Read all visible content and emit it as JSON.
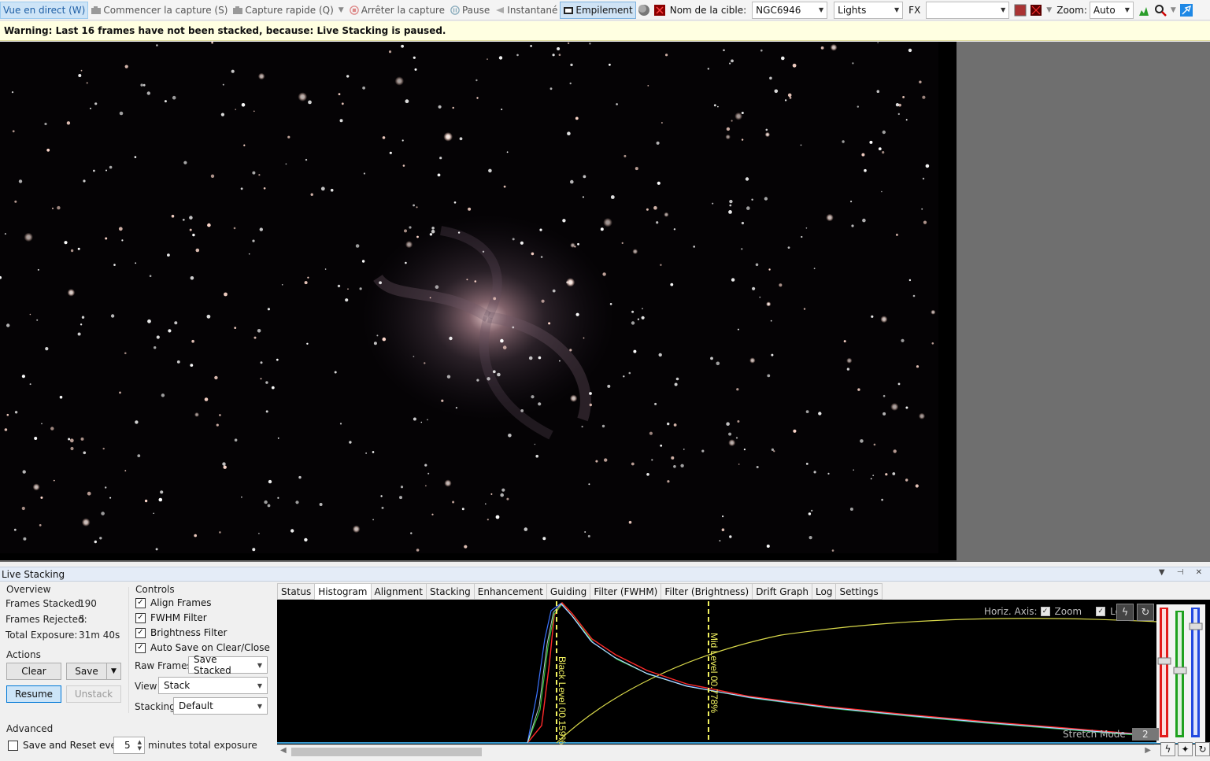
{
  "toolbar": {
    "live_view": "Vue en direct (W)",
    "start_capture": "Commencer la capture (S)",
    "quick_capture": "Capture rapide (Q)",
    "stop_capture": "Arrêter la capture",
    "pause": "Pause",
    "snapshot": "Instantané",
    "stacking": "Empilement",
    "target_label": "Nom de la cible:",
    "target_value": "NGC6946",
    "frame_type": "Lights",
    "fx_label": "FX",
    "fx_value": "",
    "zoom_label": "Zoom:",
    "zoom_value": "Auto"
  },
  "warning": "Warning: Last 16 frames have not been stacked, because: Live Stacking is paused.",
  "live_stacking": {
    "title": "Live Stacking",
    "overview": {
      "heading": "Overview",
      "frames_stacked_label": "Frames Stacked:",
      "frames_stacked": "190",
      "frames_rejected_label": "Frames Rejected:",
      "frames_rejected": "5",
      "total_exposure_label": "Total Exposure:",
      "total_exposure": "31m 40s"
    },
    "actions": {
      "heading": "Actions",
      "clear": "Clear",
      "save": "Save",
      "resume": "Resume",
      "unstack": "Unstack"
    },
    "controls": {
      "heading": "Controls",
      "align_frames": "Align Frames",
      "fwhm_filter": "FWHM Filter",
      "brightness_filter": "Brightness Filter",
      "auto_save": "Auto Save on Clear/Close",
      "raw_frames_label": "Raw Frames",
      "raw_frames_value": "Save Stacked",
      "view_label": "View",
      "view_value": "Stack",
      "stacking_label": "Stacking",
      "stacking_value": "Default"
    },
    "advanced": {
      "heading": "Advanced",
      "save_reset_label": "Save and Reset every",
      "save_reset_value": "5",
      "save_reset_suffix": "minutes total exposure"
    },
    "tabs": [
      "Status",
      "Histogram",
      "Alignment",
      "Stacking",
      "Enhancement",
      "Guiding",
      "Filter (FWHM)",
      "Filter (Brightness)",
      "Drift Graph",
      "Log",
      "Settings"
    ],
    "selected_tab": "Histogram",
    "histogram": {
      "horiz_axis_label": "Horiz. Axis:",
      "zoom_label": "Zoom",
      "log_label": "Log",
      "black_level_label": "Black Level 00.159%",
      "mid_level_label": "Mid Level 00.778%",
      "stretch_mode_label": "Stretch Mode",
      "stretch_mode_value": "2"
    }
  },
  "colors": {
    "accent": "#0078d7",
    "warning_bg": "#ffffe1",
    "sky": "#000000",
    "hist_red": "#ff2020",
    "hist_green": "#30c030",
    "hist_blue": "#3070ff",
    "hist_curve": "#d8d84a"
  }
}
